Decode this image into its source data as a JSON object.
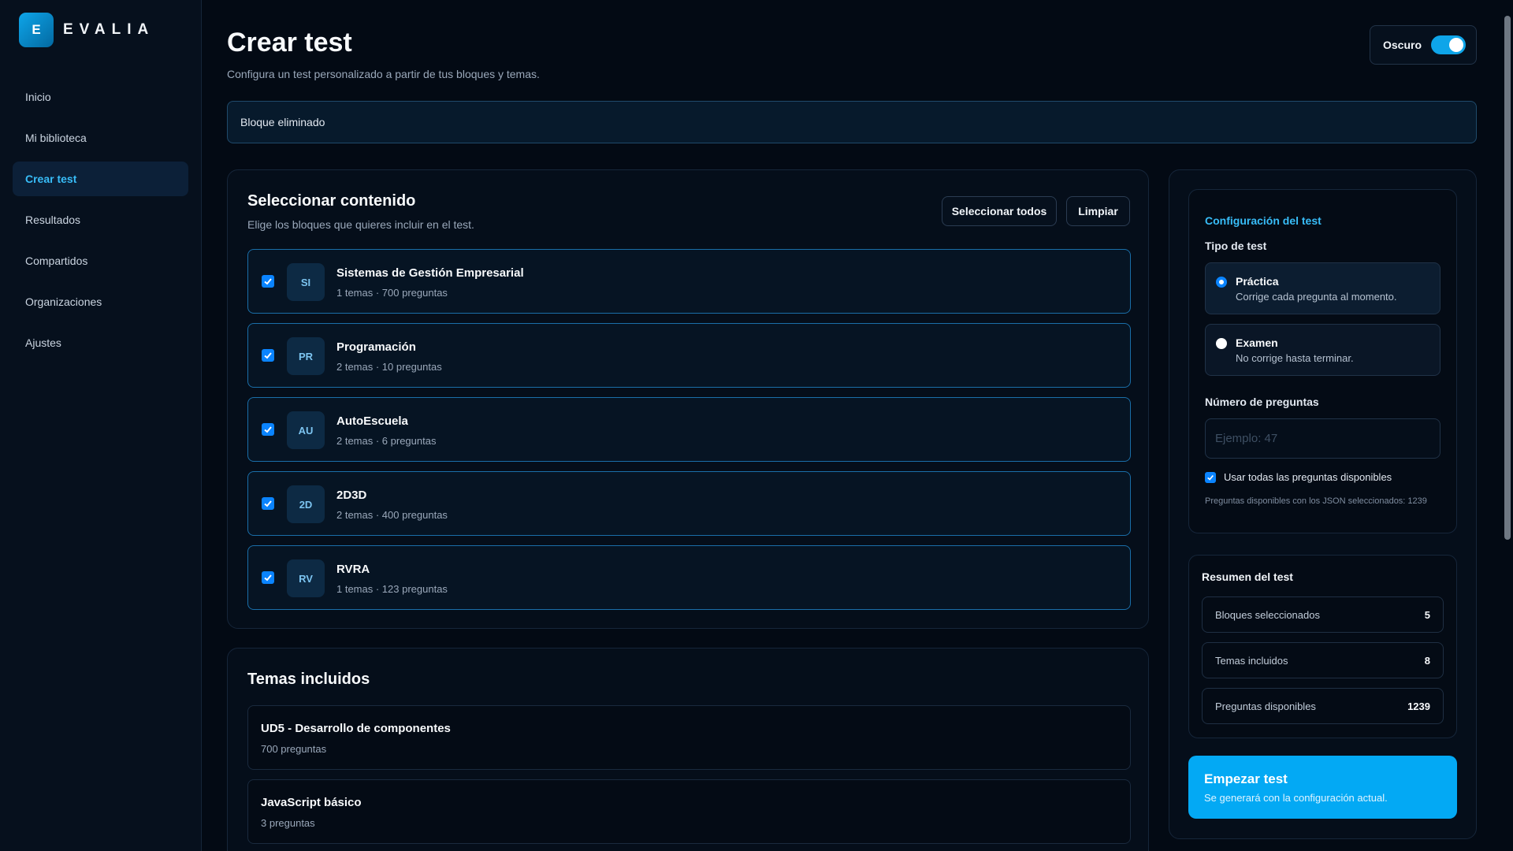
{
  "brand": {
    "logo_letter": "E",
    "name": "EVALIA"
  },
  "nav": [
    {
      "label": "Inicio",
      "active": false
    },
    {
      "label": "Mi biblioteca",
      "active": false
    },
    {
      "label": "Crear test",
      "active": true
    },
    {
      "label": "Resultados",
      "active": false
    },
    {
      "label": "Compartidos",
      "active": false
    },
    {
      "label": "Organizaciones",
      "active": false
    },
    {
      "label": "Ajustes",
      "active": false
    }
  ],
  "header": {
    "title": "Crear test",
    "subtitle": "Configura un test personalizado a partir de tus bloques y temas.",
    "theme_label": "Oscuro",
    "theme_on": true
  },
  "alert": {
    "message": "Bloque eliminado"
  },
  "content": {
    "title": "Seleccionar contenido",
    "description": "Elige los bloques que quieres incluir en el test.",
    "select_all_label": "Seleccionar todos",
    "clear_label": "Limpiar",
    "blocks": [
      {
        "initials": "SI",
        "name": "Sistemas de Gestión Empresarial",
        "meta": "1 temas · 700 preguntas",
        "checked": true
      },
      {
        "initials": "PR",
        "name": "Programación",
        "meta": "2 temas · 10 preguntas",
        "checked": true
      },
      {
        "initials": "AU",
        "name": "AutoEscuela",
        "meta": "2 temas · 6 preguntas",
        "checked": true
      },
      {
        "initials": "2D",
        "name": "2D3D",
        "meta": "2 temas · 400 preguntas",
        "checked": true
      },
      {
        "initials": "RV",
        "name": "RVRA",
        "meta": "1 temas · 123 preguntas",
        "checked": true
      }
    ]
  },
  "topics": {
    "title": "Temas incluidos",
    "items": [
      {
        "name": "UD5 - Desarrollo de componentes",
        "meta": "700 preguntas"
      },
      {
        "name": "JavaScript básico",
        "meta": "3 preguntas"
      }
    ]
  },
  "config": {
    "title": "Configuración del test",
    "type_label": "Tipo de test",
    "options": [
      {
        "name": "Práctica",
        "description": "Corrige cada pregunta al momento.",
        "selected": true
      },
      {
        "name": "Examen",
        "description": "No corrige hasta terminar.",
        "selected": false
      }
    ],
    "count_label": "Número de preguntas",
    "count_placeholder": "Ejemplo: 47",
    "use_all_label": "Usar todas las preguntas disponibles",
    "use_all_checked": true,
    "available_note": "Preguntas disponibles con los JSON seleccionados: 1239"
  },
  "summary": {
    "title": "Resumen del test",
    "rows": [
      {
        "label": "Bloques seleccionados",
        "value": "5"
      },
      {
        "label": "Temas incluidos",
        "value": "8"
      },
      {
        "label": "Preguntas disponibles",
        "value": "1239"
      }
    ]
  },
  "start": {
    "label": "Empezar test",
    "sublabel": "Se generará con la configuración actual."
  },
  "colors": {
    "background": "#030a14",
    "accent": "#0ea5e9",
    "start_button": "#03a9f4",
    "block_border": "#1a6ea8"
  }
}
